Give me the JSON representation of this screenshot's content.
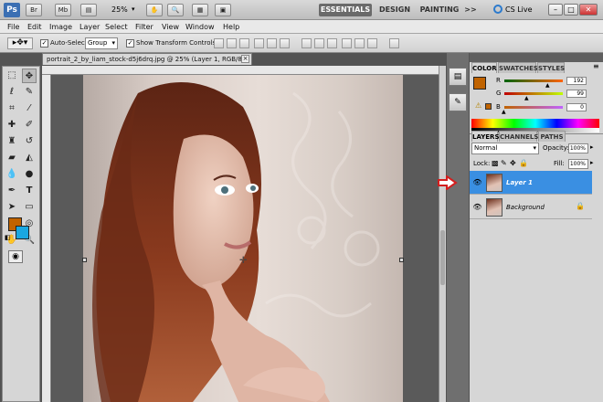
{
  "app": {
    "logo": "Ps",
    "mode_buttons": [
      "Br",
      "Mb"
    ],
    "zoom_display": "25%",
    "workspaces": [
      "ESSENTIALS",
      "DESIGN",
      "PAINTING"
    ],
    "overflow": ">>",
    "cs_live": "CS Live",
    "window_controls": [
      "–",
      "□",
      "✕"
    ]
  },
  "menu": [
    "File",
    "Edit",
    "Image",
    "Layer",
    "Select",
    "Filter",
    "View",
    "Window",
    "Help"
  ],
  "options_bar": {
    "auto_select_label": "Auto-Select:",
    "auto_select_value": "Group",
    "show_transform_label": "Show Transform Controls"
  },
  "document": {
    "tab_title": "portrait_2_by_liam_stock-d5j6drq.jpg @ 25% (Layer 1, RGB/8) *",
    "close": "×"
  },
  "color_panel": {
    "tabs": [
      "COLOR",
      "SWATCHES",
      "STYLES"
    ],
    "channels": [
      {
        "label": "R",
        "value": "192",
        "fraction": 0.75
      },
      {
        "label": "G",
        "value": "99",
        "fraction": 0.39
      },
      {
        "label": "B",
        "value": "0",
        "fraction": 0.0
      }
    ],
    "foreground": "#c06300",
    "background": "#1aa7e0"
  },
  "layers_panel": {
    "tabs": [
      "LAYERS",
      "CHANNELS",
      "PATHS"
    ],
    "blend_mode": "Normal",
    "opacity_label": "Opacity:",
    "opacity_value": "100%",
    "lock_label": "Lock:",
    "fill_label": "Fill:",
    "fill_value": "100%",
    "layers": [
      {
        "name": "Layer 1",
        "selected": true
      },
      {
        "name": "Background",
        "selected": false
      }
    ]
  },
  "colors": {
    "selection_blue": "#3a8fe2",
    "arrow_red": "#d31e1e"
  }
}
